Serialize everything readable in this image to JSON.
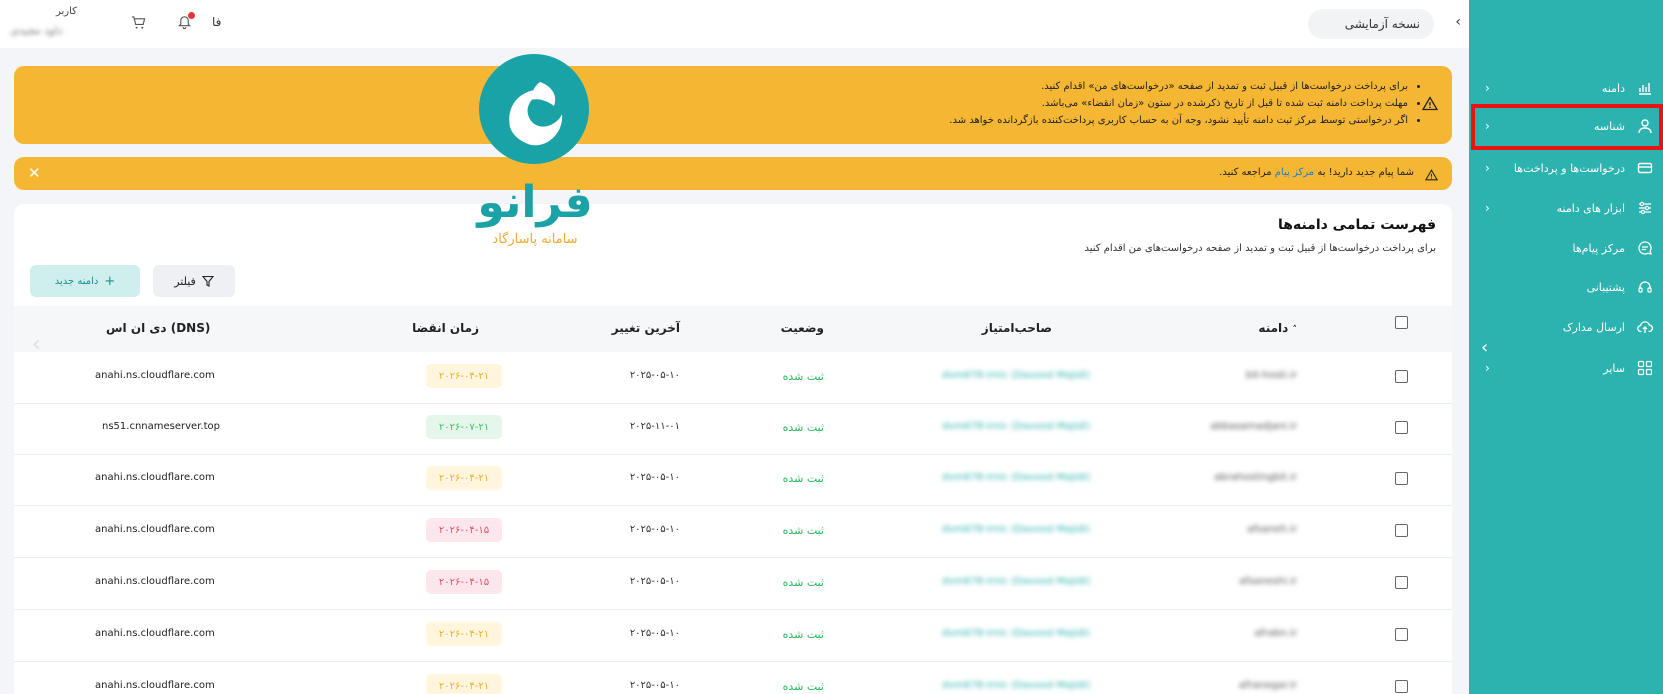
{
  "header": {
    "version_label": "نسخه آزمایشی",
    "lang": "فا",
    "user_role": "کاربر",
    "user_name": "داود مجیدی"
  },
  "sidebar": {
    "items": [
      {
        "label": "دامنه",
        "icon": "chart-icon",
        "chevron": "›"
      },
      {
        "label": "شناسه",
        "icon": "user-icon",
        "chevron": "›"
      },
      {
        "label": "درخواست‌ها و پرداخت‌ها",
        "icon": "card-icon",
        "chevron": "›"
      },
      {
        "label": "ابزار های دامنه",
        "icon": "sliders-icon",
        "chevron": "›"
      },
      {
        "label": "مرکز پیام‌ها",
        "icon": "message-icon",
        "chevron": ""
      },
      {
        "label": "پشتیبانی",
        "icon": "headset-icon",
        "chevron": ""
      },
      {
        "label": "ارسال مدارک",
        "icon": "upload-icon",
        "chevron": ""
      },
      {
        "label": "سایر",
        "icon": "grid-icon",
        "chevron": "›"
      }
    ],
    "highlighted_item": "شناسه"
  },
  "alerts": {
    "warning_lines": [
      "برای پرداخت درخواست‌ها از قبیل ثبت و تمدید از صفحه «درخواست‌های من» اقدام کنید.",
      "مهلت پرداخت دامنه ثبت شده تا قبل از تاریخ ذکرشده در ستون «زمان انقضاء» می‌باشد.",
      "اگر درخواستی توسط مرکز ثبت دامنه تأیید نشود، وجه آن به حساب کاربری پرداخت‌کننده بازگردانده خواهد شد."
    ],
    "message_prefix": "شما پیام جدید دارید! به",
    "message_link": "مرکز پیام",
    "message_suffix": "مراجعه کنید."
  },
  "logo": {
    "text": "فرانو",
    "subtitle": "سامانه پاسارگاد",
    "color_primary": "#1aa3a7",
    "color_accent": "#f0a82a"
  },
  "domains": {
    "title": "فهرست تمامی دامنه‌ها",
    "subtitle": "برای پرداخت درخواست‌ها از قبیل ثبت و تمدید از صفحه درخواست‌های من اقدام کنید",
    "filter_label": "فیلتر",
    "new_label": "دامنه جدید",
    "columns": {
      "domain": "دامنه",
      "owner": "صاحب‌امتیاز",
      "status": "وضعیت",
      "last_change": "آخرین تغییر",
      "expiry": "زمان انقضا",
      "dns": "دی ان اس (DNS)"
    },
    "rows": [
      {
        "domain": "bit-hosti.ir",
        "owner": "dvm678-irnic (Davood Majidi)",
        "status": "ثبت شده",
        "last_change": "۲۰۲۵-۰۵-۱۰",
        "expiry": "۲۰۲۶-۰۴-۲۱",
        "expiry_color": "yellow",
        "dns": "anahi.ns.cloudflare.com"
      },
      {
        "domain": "abbasamadjani.ir",
        "owner": "dvm678-irnic (Davood Majidi)",
        "status": "ثبت شده",
        "last_change": "۲۰۲۵-۱۱-۰۱",
        "expiry": "۲۰۲۶-۰۷-۲۱",
        "expiry_color": "green",
        "dns": "ns51.cnnameserver.top"
      },
      {
        "domain": "abrahostingbit.ir",
        "owner": "dvm678-irnic (Davood Majidi)",
        "status": "ثبت شده",
        "last_change": "۲۰۲۵-۰۵-۱۰",
        "expiry": "۲۰۲۶-۰۴-۲۱",
        "expiry_color": "yellow",
        "dns": "anahi.ns.cloudflare.com"
      },
      {
        "domain": "afsaneh.ir",
        "owner": "dvm678-irnic (Davood Majidi)",
        "status": "ثبت شده",
        "last_change": "۲۰۲۵-۰۵-۱۰",
        "expiry": "۲۰۲۶-۰۴-۱۵",
        "expiry_color": "red",
        "dns": "anahi.ns.cloudflare.com"
      },
      {
        "domain": "afsaneshi.ir",
        "owner": "dvm678-irnic (Davood Majidi)",
        "status": "ثبت شده",
        "last_change": "۲۰۲۵-۰۵-۱۰",
        "expiry": "۲۰۲۶-۰۴-۱۵",
        "expiry_color": "red",
        "dns": "anahi.ns.cloudflare.com"
      },
      {
        "domain": "afrabn.ir",
        "owner": "dvm678-irnic (Davood Majidi)",
        "status": "ثبت شده",
        "last_change": "۲۰۲۵-۰۵-۱۰",
        "expiry": "۲۰۲۶-۰۴-۲۱",
        "expiry_color": "yellow",
        "dns": "anahi.ns.cloudflare.com"
      },
      {
        "domain": "afranegar.ir",
        "owner": "dvm678-irnic (Davood Majidi)",
        "status": "ثبت شده",
        "last_change": "۲۰۲۵-۰۵-۱۰",
        "expiry": "۲۰۲۶-۰۴-۲۱",
        "expiry_color": "yellow",
        "dns": "anahi.ns.cloudflare.com"
      }
    ]
  },
  "colors": {
    "sidebar": "#2cb3b0",
    "alert": "#f5b733",
    "highlight": "#ee1111",
    "status_ok": "#27b85a"
  }
}
